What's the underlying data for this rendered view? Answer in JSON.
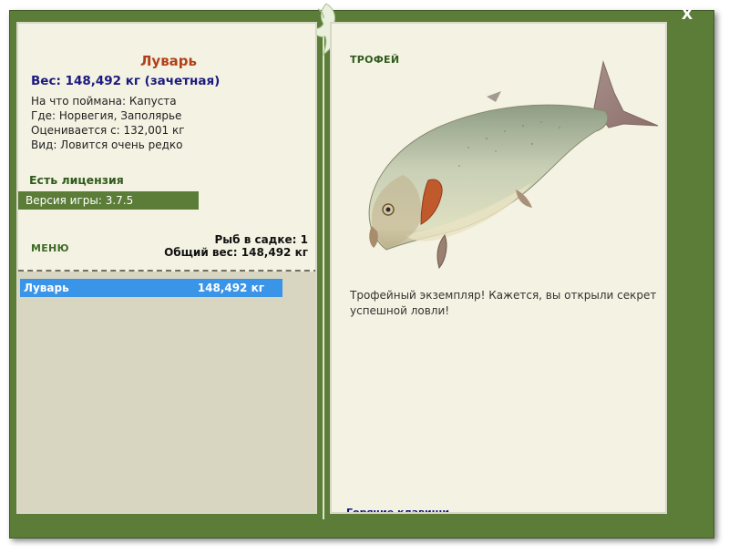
{
  "window": {
    "close_label": "X"
  },
  "fish": {
    "name": "Луварь",
    "weight_line": "Вес: 148,492 кг (зачетная)",
    "details": [
      "На что поймана: Капуста",
      "Где: Норвегия, Заполярье",
      "Оценивается с: 132,001 кг",
      "Вид: Ловится очень редко"
    ]
  },
  "license": {
    "label": "Есть лицензия"
  },
  "version": {
    "label": "Версия игры: 3.7.5"
  },
  "menu": {
    "label": "МЕНЮ"
  },
  "keepnet": {
    "count_line": "Рыб в садке: 1",
    "total_line": "Общий вес: 148,492 кг"
  },
  "catch_list": [
    {
      "name": "Луварь",
      "weight": "148,492 кг"
    }
  ],
  "trophy": {
    "title": "ТРОФЕЙ",
    "description": "Трофейный экземпляр! Кажется, вы открыли секрет успешной ловли!"
  },
  "footer": {
    "hotkeys_label": "Горячие клавиши"
  },
  "colors": {
    "window_green": "#5b7d38",
    "panel_bg": "#f4f2e2",
    "name_color": "#b2401a",
    "weight_color": "#1a1a80",
    "selected_row": "#3a95e8"
  },
  "icons": {
    "emblem": "fish-emblem-icon",
    "close": "close-icon",
    "trophy_image": "luvar-fish-image"
  }
}
